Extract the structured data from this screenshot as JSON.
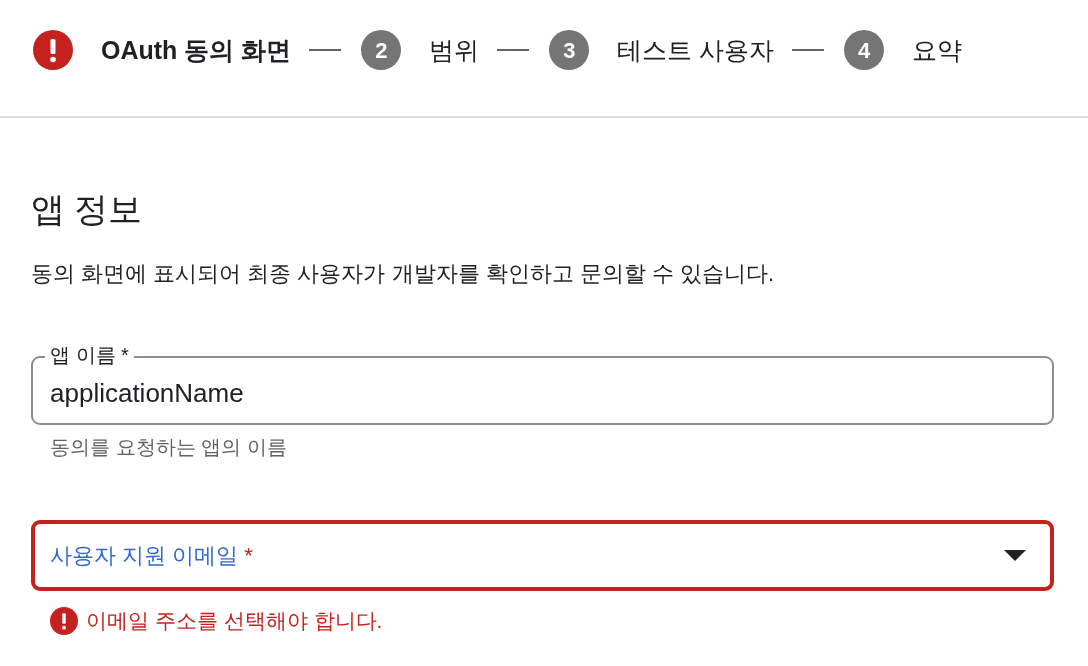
{
  "stepper": {
    "steps": [
      {
        "kind": "error",
        "label": "OAuth 동의 화면",
        "selected": true
      },
      {
        "kind": "number",
        "number": "2",
        "label": "범위",
        "selected": false
      },
      {
        "kind": "number",
        "number": "3",
        "label": "테스트 사용자",
        "selected": false
      },
      {
        "kind": "number",
        "number": "4",
        "label": "요약",
        "selected": false
      }
    ]
  },
  "section": {
    "title": "앱 정보",
    "description": "동의 화면에 표시되어 최종 사용자가 개발자를 확인하고 문의할 수 있습니다."
  },
  "fields": [
    {
      "kind": "text",
      "label": "앱 이름",
      "required_mark": "*",
      "value": "applicationName",
      "helper": "동의를 요청하는 앱의 이름",
      "focused": false,
      "error": false
    },
    {
      "kind": "select",
      "label": "사용자 지원 이메일",
      "required_mark": "*",
      "focused": true,
      "error": true,
      "error_message": "이메일 주소를 선택해야 합니다."
    }
  ]
}
